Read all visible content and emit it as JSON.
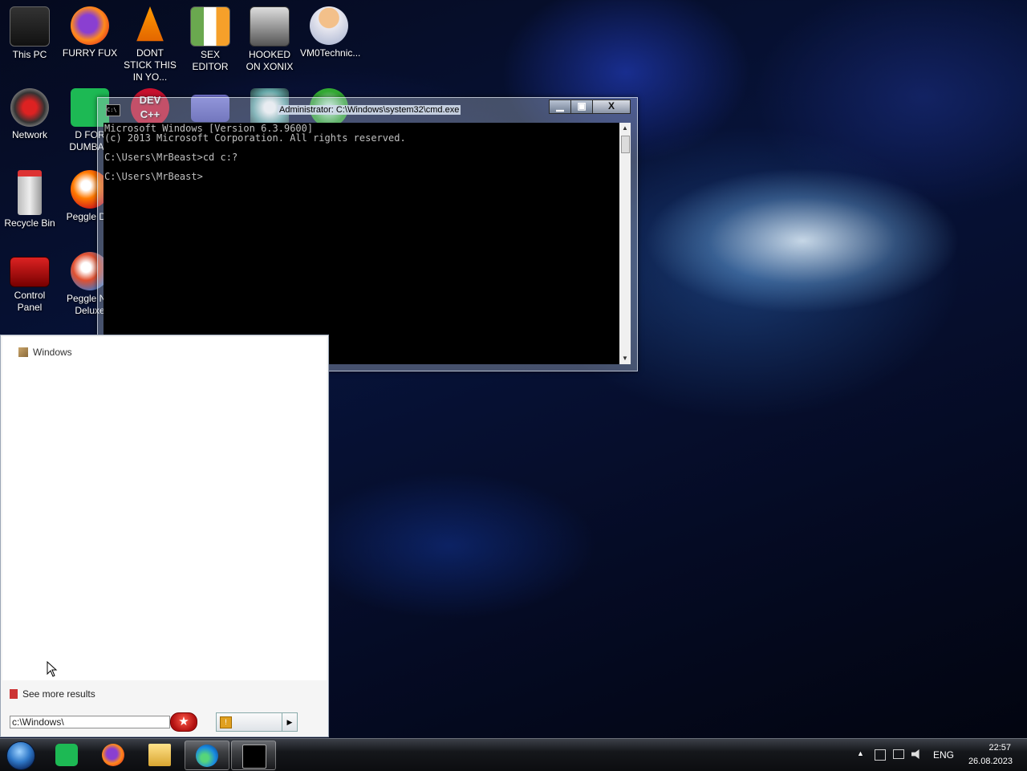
{
  "desktop": {
    "icons": [
      {
        "label": "This PC"
      },
      {
        "label": "FURRY FUX"
      },
      {
        "label": "DONT STICK THIS IN YO..."
      },
      {
        "label": "SEX EDITOR"
      },
      {
        "label": "HOOKED ON XONIX"
      },
      {
        "label": "VM0Technic..."
      },
      {
        "label": "Network"
      },
      {
        "label": "D FOR DUMBAS"
      },
      {
        "label": "Recycle Bin"
      },
      {
        "label": "Peggle Del"
      },
      {
        "label": "Control Panel"
      },
      {
        "label": "Peggle Nic Deluxe"
      }
    ],
    "dev_icon_text": "DEV\nC++"
  },
  "cmd_window": {
    "title": "Administrator: C:\\Windows\\system32\\cmd.exe",
    "icon_text": "C:\\",
    "buttons": {
      "minimize": "▁",
      "maximize": "▣",
      "close": "X"
    },
    "console_lines": [
      "Microsoft Windows [Version 6.3.9600]",
      "(c) 2013 Microsoft Corporation. All rights reserved.",
      "",
      "C:\\Users\\MrBeast>cd c:?",
      "",
      "C:\\Users\\MrBeast>"
    ]
  },
  "start_menu": {
    "group_header": "Windows",
    "see_more": "See more results",
    "search_value": "c:\\Windows\\",
    "search_button_icon": "star-icon",
    "shutdown_arrow": "▶"
  },
  "taskbar": {
    "pinned": [
      "start-orb",
      "app-green-icon",
      "firefox-icon",
      "explorer-icon",
      "edge-icon",
      "cmd-icon"
    ],
    "tray": {
      "overflow": "▲",
      "language": "ENG",
      "time": "22:57",
      "date": "26.08.2023"
    }
  },
  "colors": {
    "console_bg": "#000000",
    "console_fg": "#c0c0c0",
    "taskbar": "#15171b"
  }
}
